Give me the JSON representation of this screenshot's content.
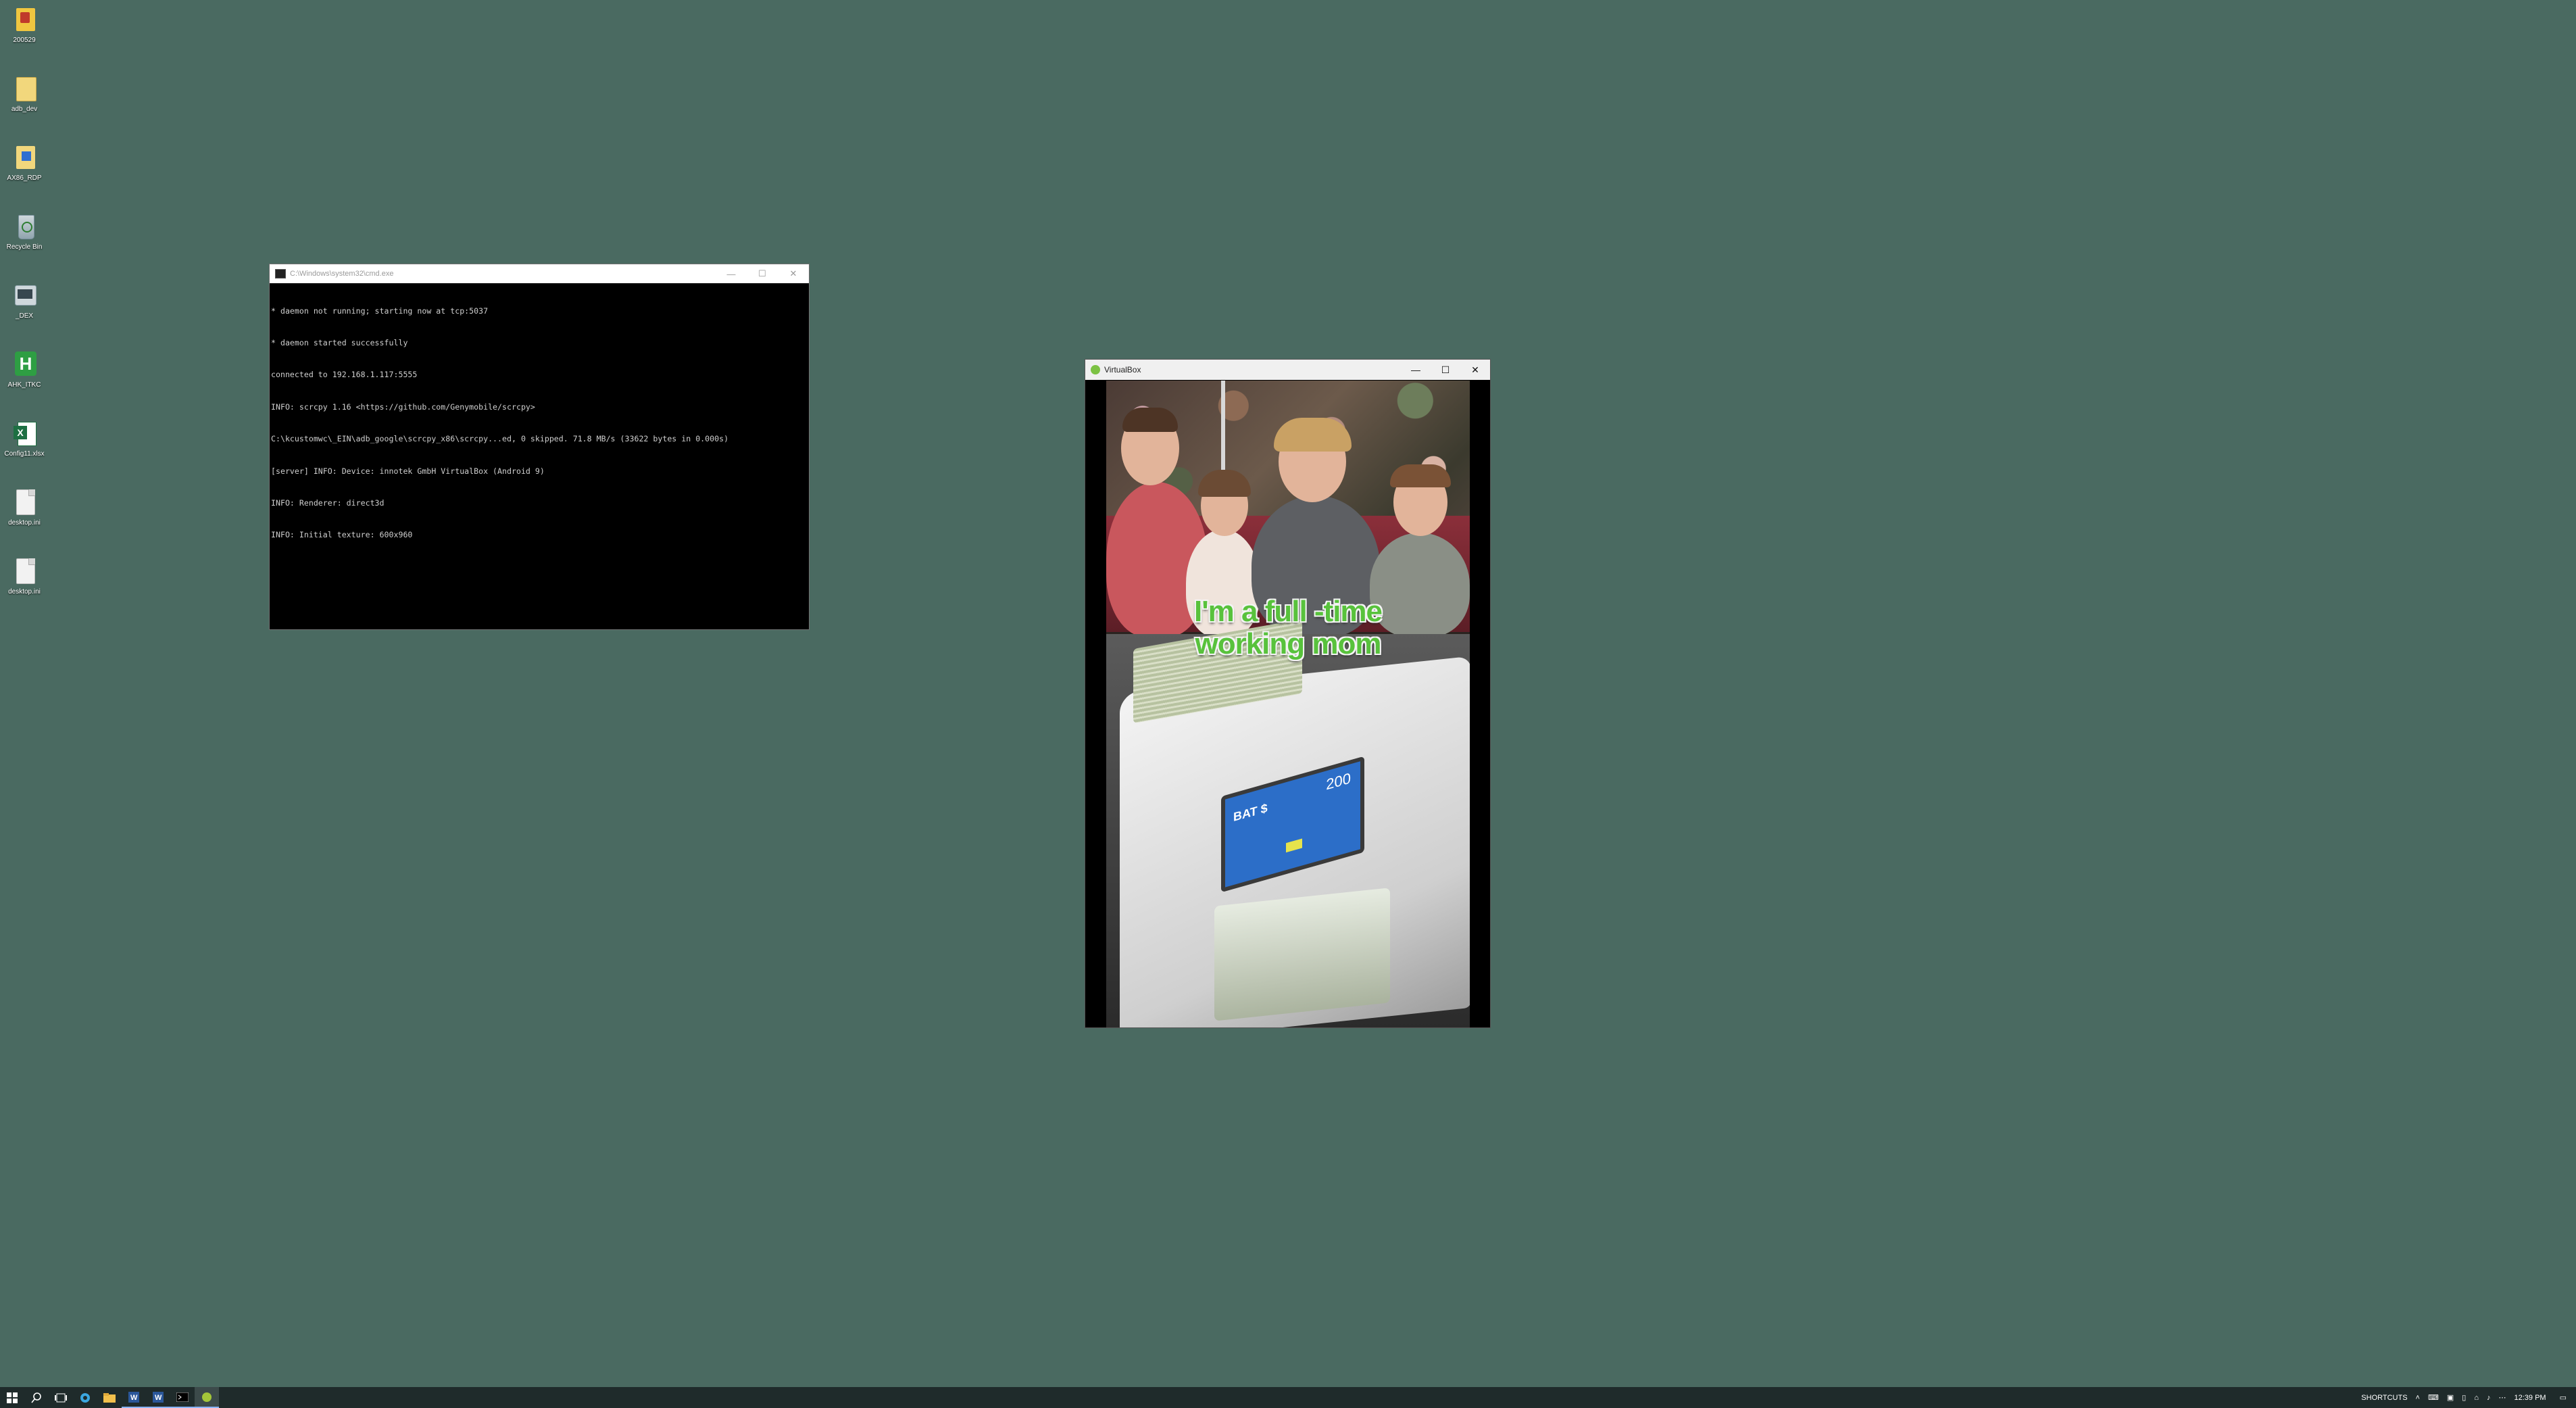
{
  "desktop": {
    "icons": [
      {
        "label": "200529"
      },
      {
        "label": "adb_dev"
      },
      {
        "label": "AX86_RDP"
      },
      {
        "label": "Recycle Bin"
      },
      {
        "label": "_DEX"
      },
      {
        "label": "AHK_ITKC"
      },
      {
        "label": "Config11.xlsx"
      },
      {
        "label": "desktop.ini"
      },
      {
        "label": "desktop.ini"
      }
    ]
  },
  "cmd_window": {
    "title": "C:\\Windows\\system32\\cmd.exe",
    "lines": [
      "* daemon not running; starting now at tcp:5037",
      "* daemon started successfully",
      "connected to 192.168.1.117:5555",
      "INFO: scrcpy 1.16 <https://github.com/Genymobile/scrcpy>",
      "C:\\kcustomwc\\_EIN\\adb_google\\scrcpy_x86\\scrcpy...ed, 0 skipped. 71.8 MB/s (33622 bytes in 0.000s)",
      "[server] INFO: Device: innotek GmbH VirtualBox (Android 9)",
      "INFO: Renderer: direct3d",
      "INFO: Initial texture: 600x960"
    ]
  },
  "vbox_window": {
    "title": "VirtualBox",
    "caption_line1": "I'm a full -time",
    "caption_line2": "working mom",
    "counter_screen_label": "BAT $",
    "counter_screen_value": "200"
  },
  "taskbar": {
    "shortcuts_label": "SHORTCUTS",
    "time": "12:39 PM"
  },
  "window_controls": {
    "minimize": "—",
    "maximize": "☐",
    "close": "✕"
  }
}
